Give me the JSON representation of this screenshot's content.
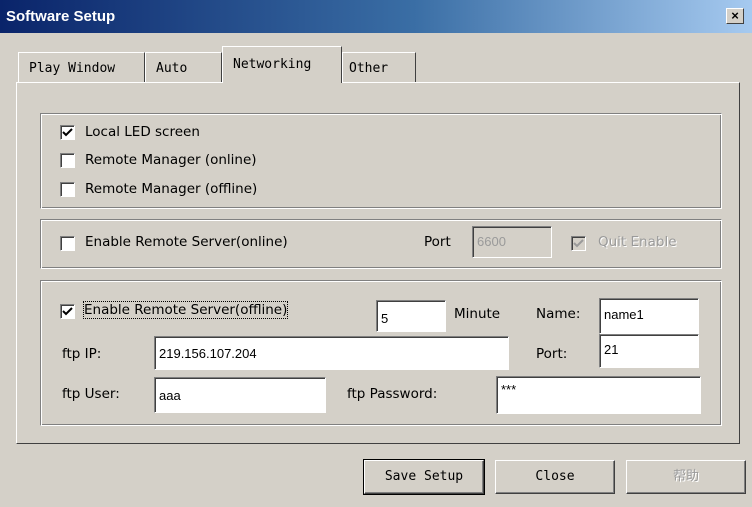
{
  "window": {
    "title": "Software Setup",
    "close_glyph": "×"
  },
  "tabs": [
    {
      "label": "Play Window",
      "active": false
    },
    {
      "label": "Auto",
      "active": false
    },
    {
      "label": "Networking",
      "active": true
    },
    {
      "label": "Other",
      "active": false
    }
  ],
  "display_group": {
    "local_led": {
      "label": "Local LED screen",
      "checked": true
    },
    "remote_online": {
      "label": "Remote Manager (online)",
      "checked": false
    },
    "remote_offline": {
      "label": "Remote Manager (offline)",
      "checked": false
    }
  },
  "online_server": {
    "enable": {
      "label": "Enable Remote Server(online)",
      "checked": false
    },
    "port_label": "Port",
    "port_value": "6600",
    "quit_enable": {
      "label": "Quit Enable",
      "checked": true,
      "disabled": true
    }
  },
  "offline_server": {
    "enable": {
      "label": "Enable Remote Server(offline)",
      "checked": true
    },
    "minutes_value": "5",
    "minute_label": "Minute",
    "name_label": "Name:",
    "name_value": "name1",
    "ftp_ip_label": "ftp IP:",
    "ftp_ip_value": "219.156.107.204",
    "port_label": "Port:",
    "port_value": "21",
    "ftp_user_label": "ftp User:",
    "ftp_user_value": "aaa",
    "ftp_password_label": "ftp Password:",
    "ftp_password_value": "***"
  },
  "buttons": {
    "save": "Save Setup",
    "close": "Close",
    "help": "帮助"
  }
}
